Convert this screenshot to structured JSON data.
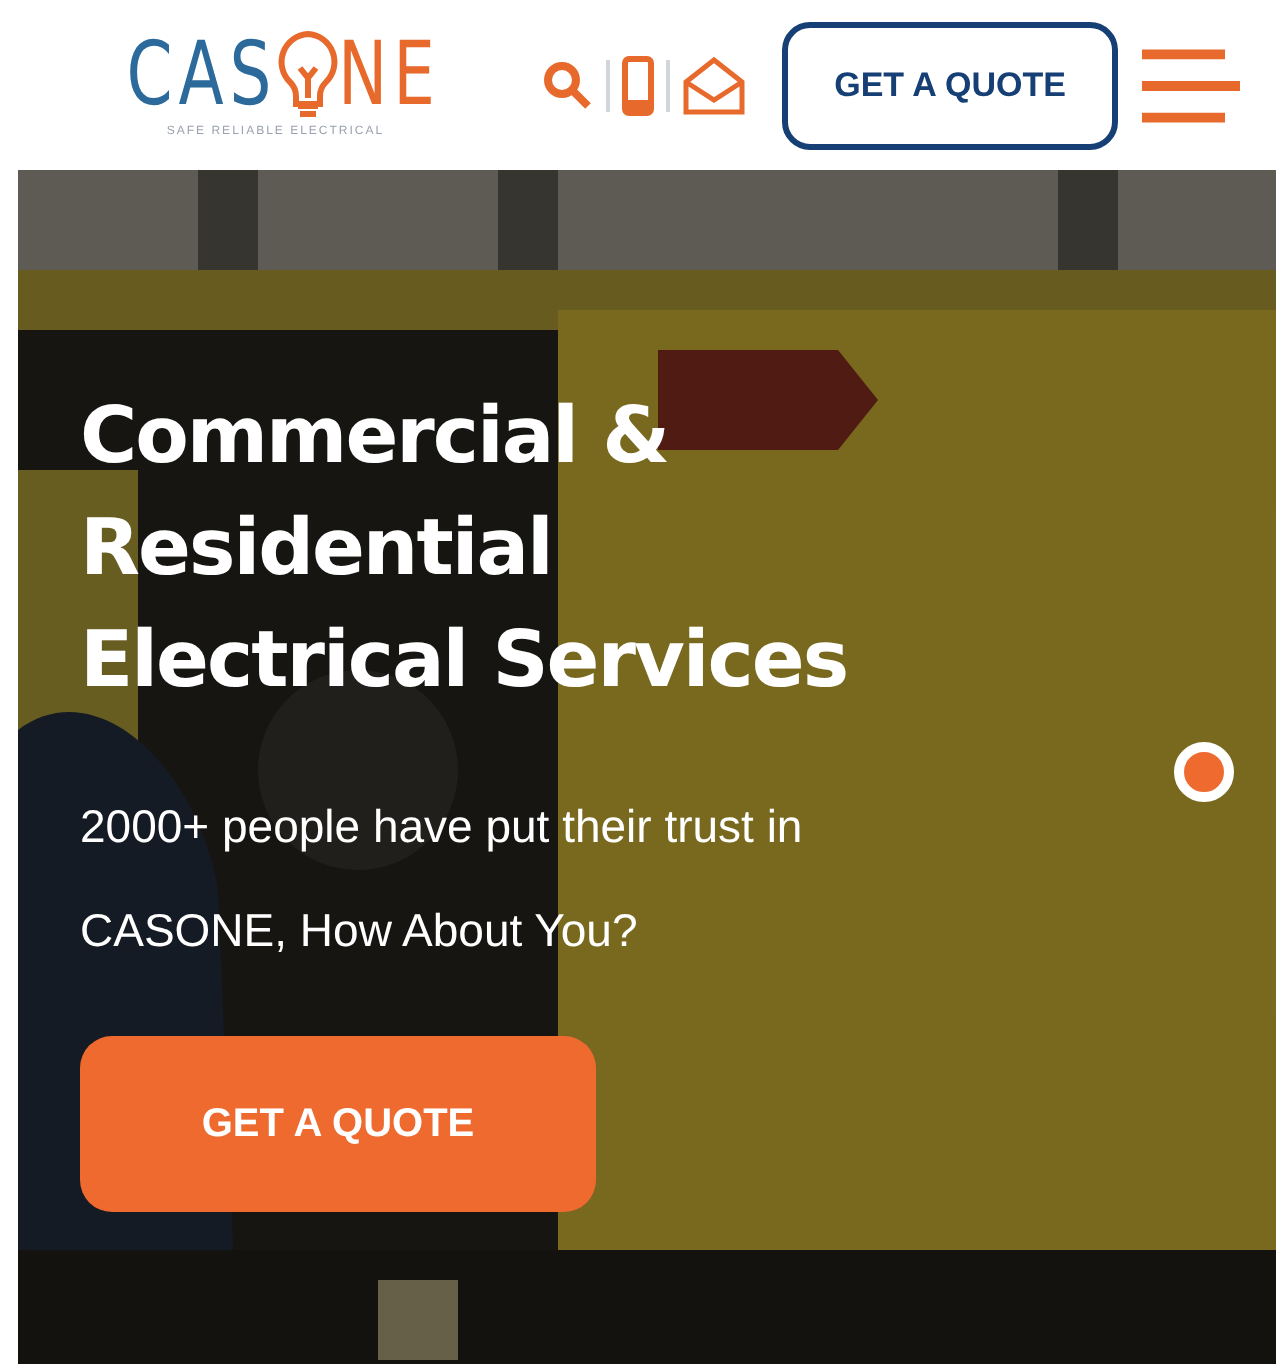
{
  "header": {
    "logo": {
      "left": "CAS",
      "right": "NE",
      "tagline": "SAFE RELIABLE ELECTRICAL"
    },
    "quote_button": "GET A QUOTE"
  },
  "hero": {
    "heading": [
      "Commercial &",
      "Residential",
      "Electrical Services"
    ],
    "text": [
      "2000+ people have put their trust in",
      "CASONE, How About You?"
    ],
    "button": "GET A QUOTE",
    "slider_dots": [
      {
        "selected": true
      }
    ]
  }
}
